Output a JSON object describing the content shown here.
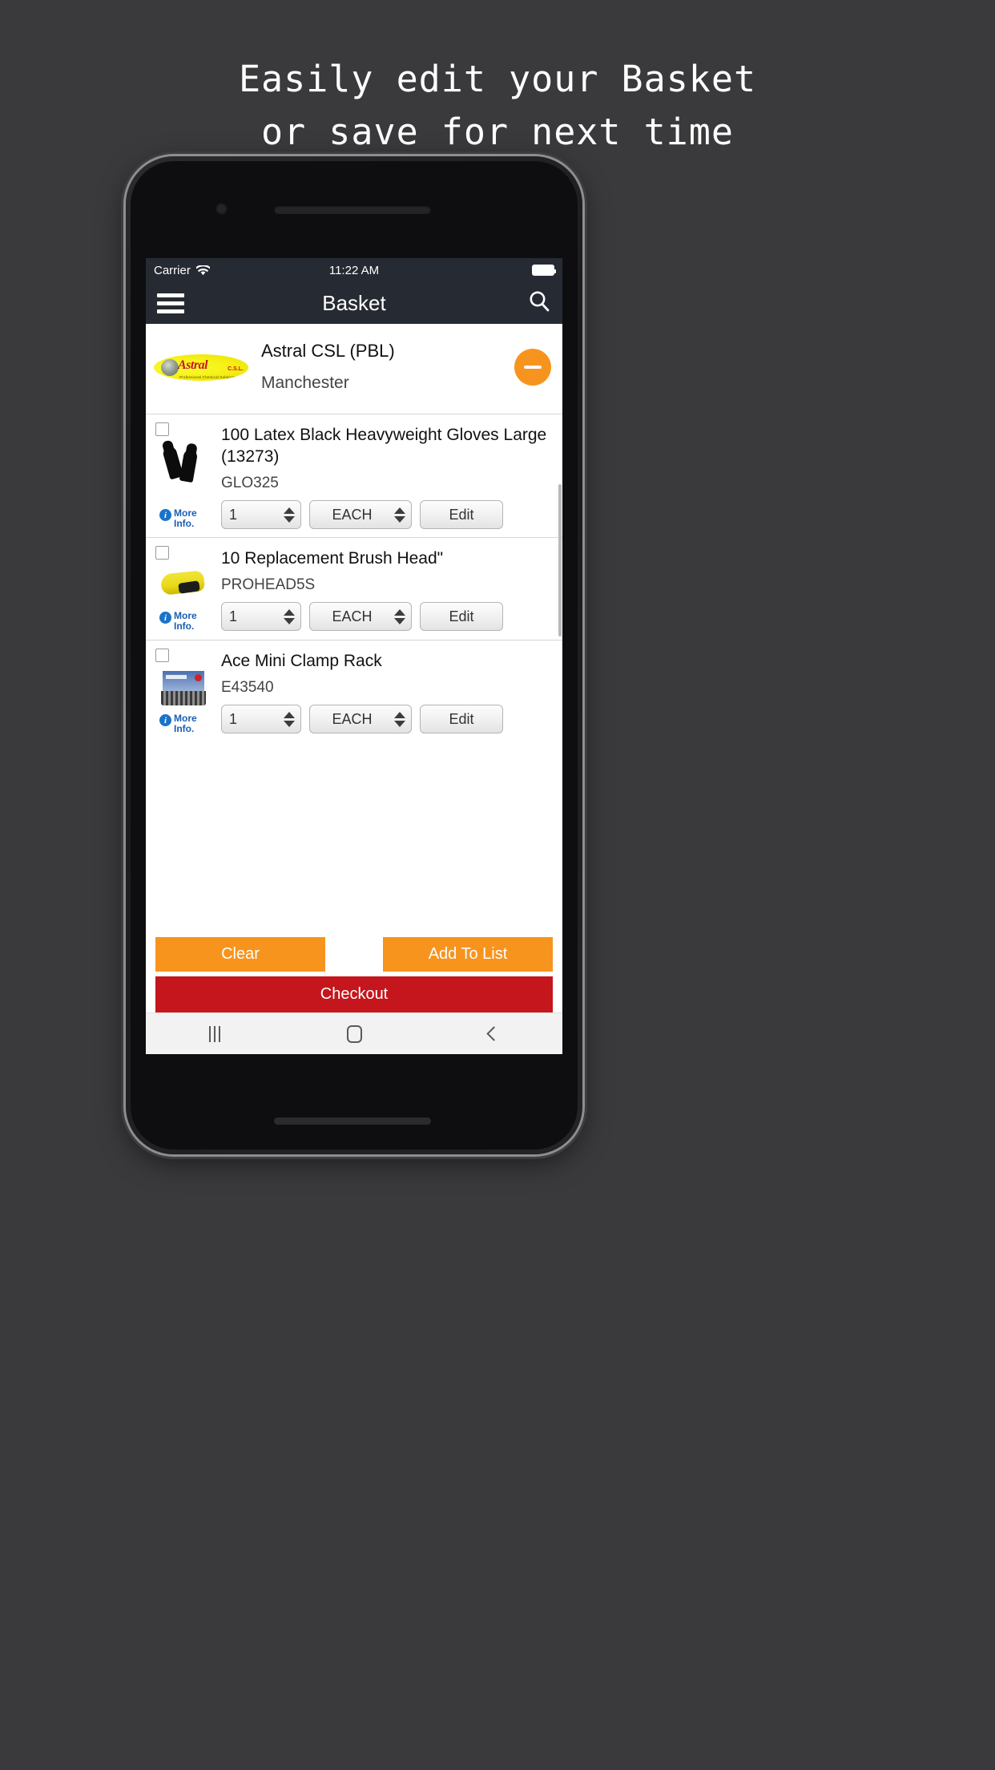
{
  "headline": {
    "line1": "Easily edit your Basket",
    "line2": "or save for next time"
  },
  "statusbar": {
    "carrier": "Carrier",
    "time": "11:22 AM",
    "wifi_icon": "wifi-icon",
    "battery_icon": "battery-icon"
  },
  "navbar": {
    "menu_icon": "hamburger-menu-icon",
    "title": "Basket",
    "search_icon": "search-icon"
  },
  "account": {
    "logo_word": "Astral",
    "logo_csl": "C.S.L.",
    "logo_tagline": "Professional Chemical Solutions",
    "name": "Astral CSL (PBL)",
    "location": "Manchester",
    "remove_icon": "minus-icon"
  },
  "products": [
    {
      "title": "100 Latex Black Heavyweight Gloves Large (13273)",
      "sku": "GLO325",
      "qty": "1",
      "unit": "EACH",
      "edit_label": "Edit",
      "more_info": "More Info.",
      "thumb_icon": "black-gloves-image"
    },
    {
      "title": "10 Replacement Brush Head\"",
      "sku": "PROHEAD5S",
      "qty": "1",
      "unit": "EACH",
      "edit_label": "Edit",
      "more_info": "More Info.",
      "thumb_icon": "yellow-brush-head-image"
    },
    {
      "title": "Ace Mini Clamp Rack",
      "sku": "E43540",
      "qty": "1",
      "unit": "EACH",
      "edit_label": "Edit",
      "more_info": "More Info.",
      "thumb_icon": "clamp-rack-image"
    }
  ],
  "footer": {
    "clear_label": "Clear",
    "add_to_list_label": "Add To List",
    "checkout_label": "Checkout"
  },
  "androidnav": {
    "recents_icon": "recents-icon",
    "home_icon": "home-icon",
    "back_icon": "back-icon"
  },
  "colors": {
    "page_background": "#3a3a3c",
    "navbar": "#262a33",
    "accent_orange": "#f7941e",
    "checkout_red": "#c4161c",
    "link_blue": "#1a5fb4"
  }
}
